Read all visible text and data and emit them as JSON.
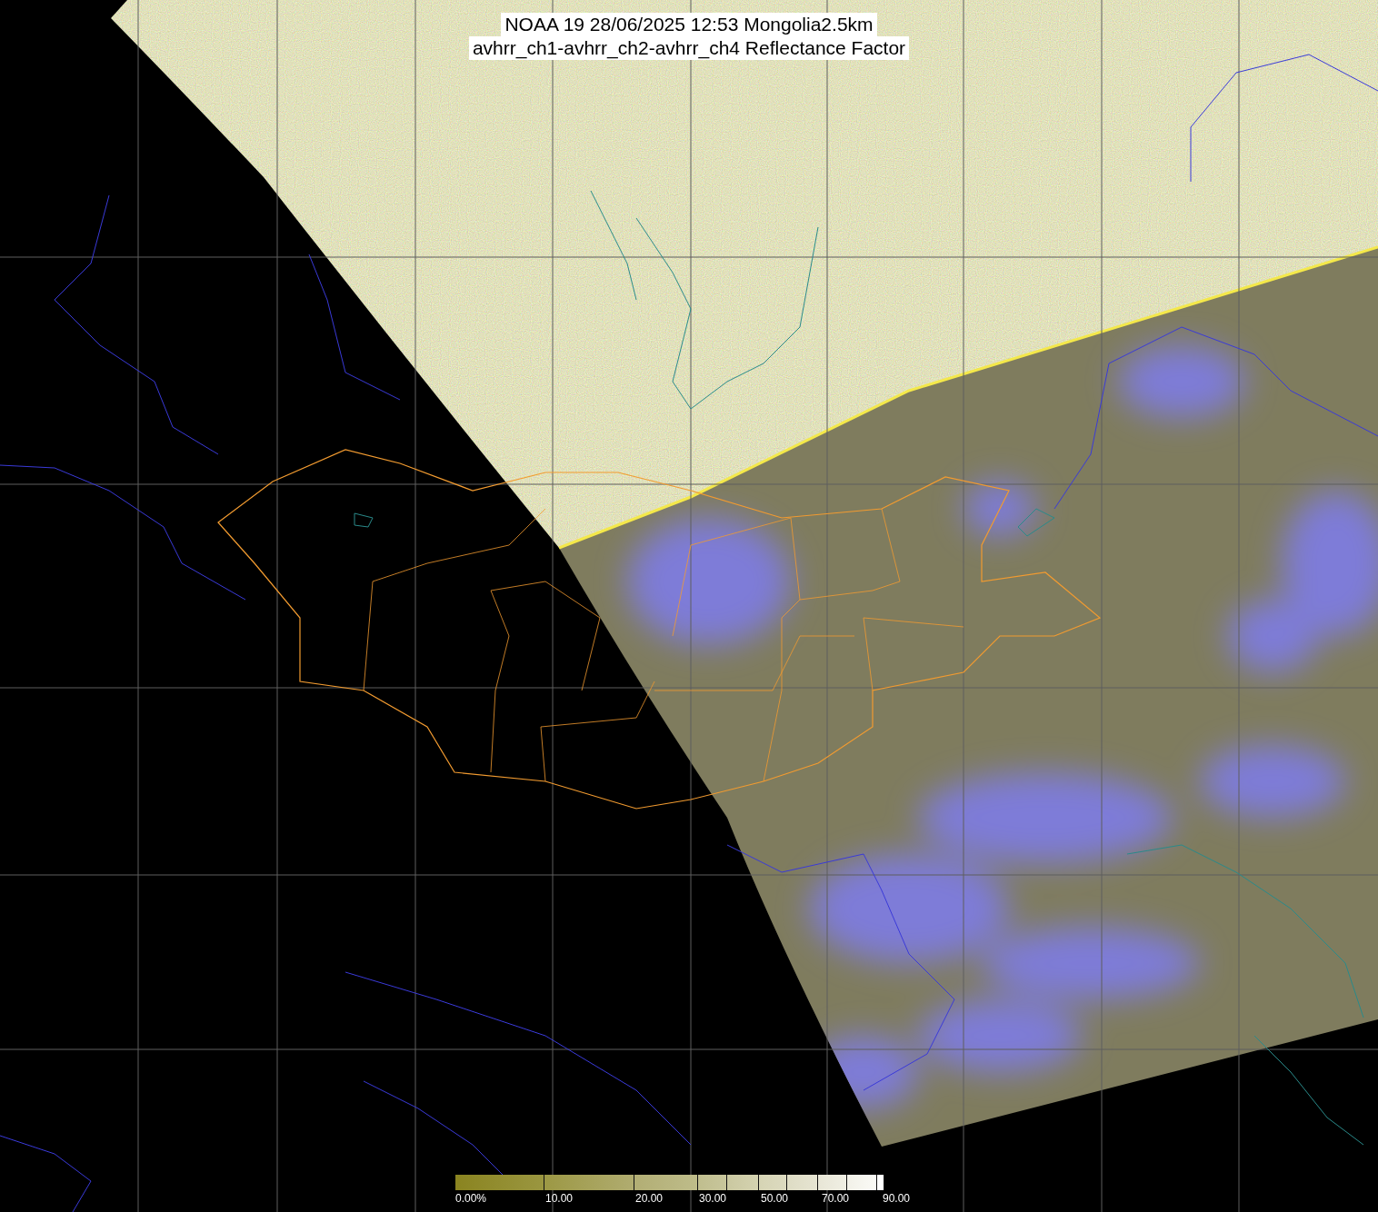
{
  "title": {
    "lines": [
      "NOAA 19 28/06/2025 12:53 Mongolia2.5km",
      "avhrr_ch1-avhrr_ch2-avhrr_ch4 Reflectance Factor"
    ]
  },
  "color_scale": {
    "labels": [
      "0.00%",
      "10.00",
      "20.00",
      "30.00",
      "50.00",
      "70.00",
      "90.00"
    ]
  }
}
